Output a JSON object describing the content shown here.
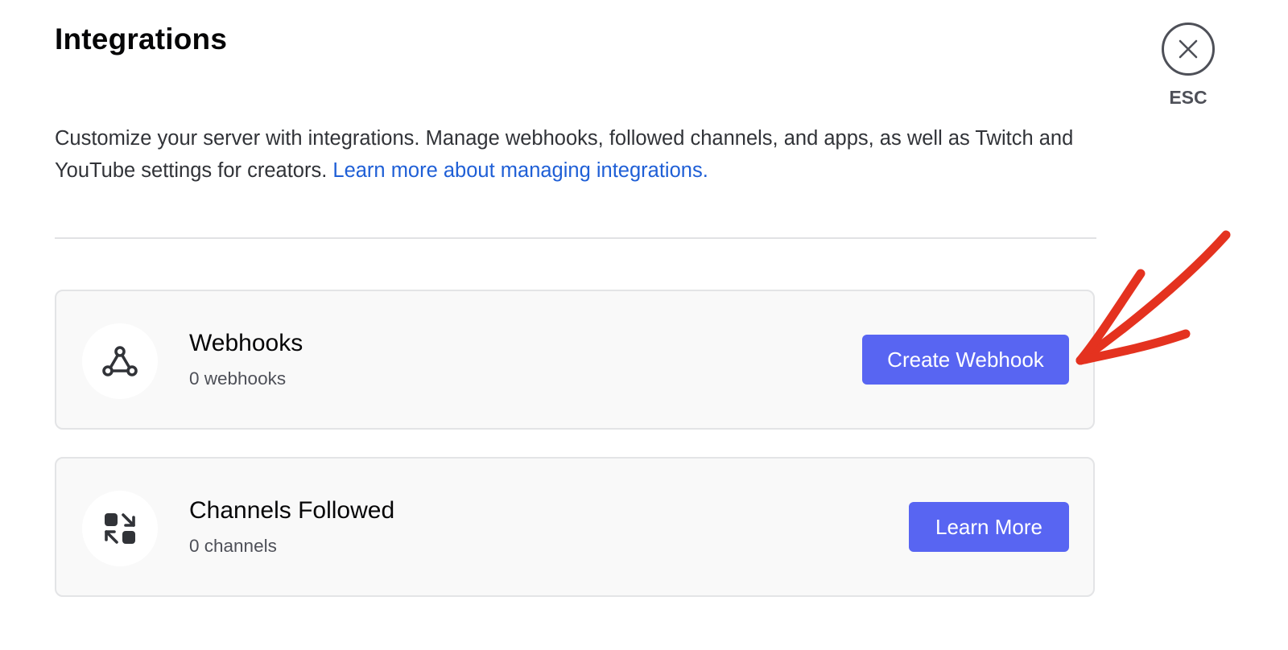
{
  "header": {
    "title": "Integrations",
    "close_label": "ESC"
  },
  "description": {
    "text": "Customize your server with integrations. Manage webhooks, followed channels, and apps, as well as Twitch and YouTube settings for creators. ",
    "link_text": "Learn more about managing integrations."
  },
  "cards": [
    {
      "icon": "webhook-icon",
      "title": "Webhooks",
      "subtitle": "0 webhooks",
      "button": "Create Webhook"
    },
    {
      "icon": "channels-followed-icon",
      "title": "Channels Followed",
      "subtitle": "0 channels",
      "button": "Learn More"
    }
  ],
  "annotation": {
    "icon": "red-arrow-icon",
    "color": "#e4321f"
  },
  "colors": {
    "accent": "#5865f2",
    "link": "#1f5fd6",
    "annotation": "#e4321f"
  }
}
